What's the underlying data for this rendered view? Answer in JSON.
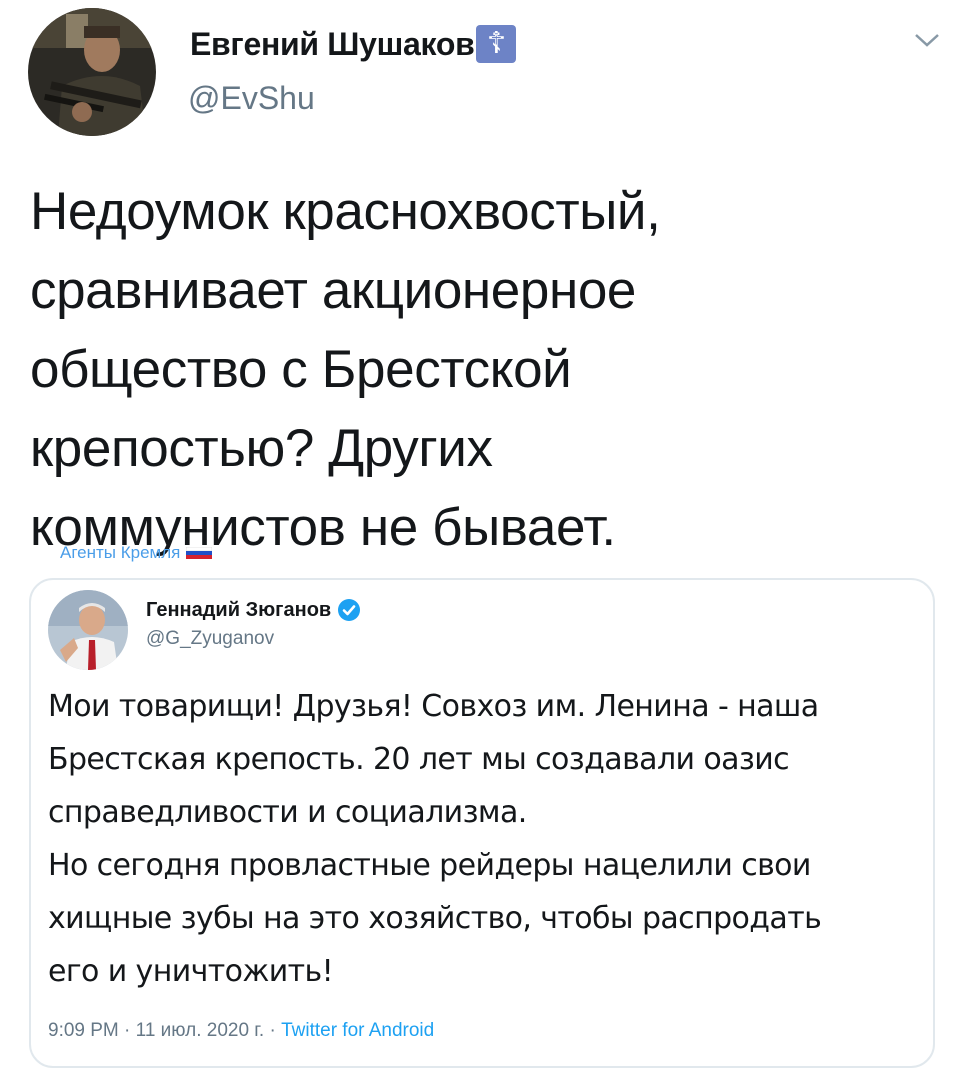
{
  "tweet": {
    "author": {
      "display_name": "Евгений Шушаков",
      "badge_icon": "orthodox-cross-icon",
      "badge_symbol": "☦",
      "handle": "@EvShu"
    },
    "text": "Недоумок краснохвостый,\nсравнивает акционерное\nобщество с Брестской\nкрепостью? Других\nкоммунистов не бывает.",
    "more_icon": "chevron-down-icon"
  },
  "watermark": {
    "text": "Агенты Кремля",
    "flag_icon": "russian-flag-icon"
  },
  "quoted_tweet": {
    "author": {
      "display_name": "Геннадий Зюганов",
      "verified_icon": "verified-badge-icon",
      "handle": "@G_Zyuganov"
    },
    "text": "Мои товарищи! Друзья! Совхоз им. Ленина - наша\nБрестская крепость. 20 лет мы создавали оазис\nсправедливости и социализма.\nНо сегодня провластные рейдеры нацелили свои\nхищные зубы на это хозяйство, чтобы распродать\nего и уничтожить!",
    "time": "9:09 PM",
    "date": "11 июл. 2020 г.",
    "separator": "·",
    "source": "Twitter for Android"
  },
  "colors": {
    "text_primary": "#14171a",
    "text_secondary": "#657786",
    "link": "#1da1f2",
    "border": "#e1e8ed",
    "badge_bg": "#6d83c6"
  }
}
